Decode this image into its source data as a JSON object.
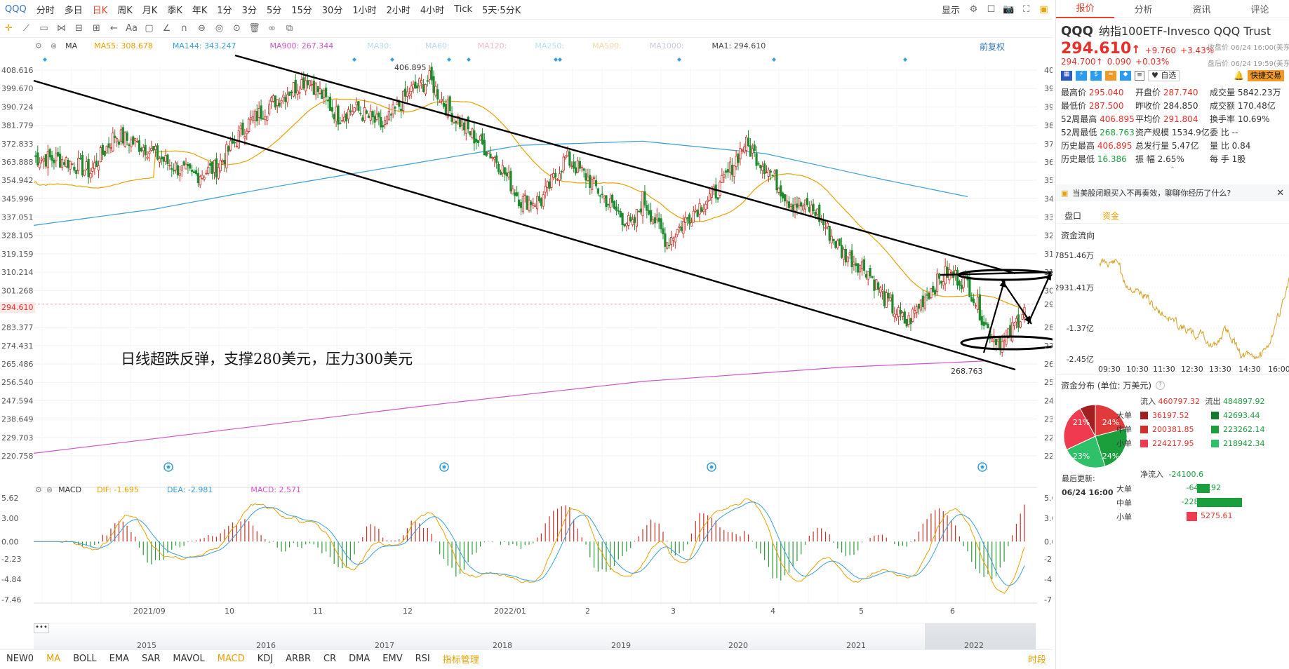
{
  "toolbar": {
    "periods": [
      "QQQ",
      "分时",
      "多日",
      "日K",
      "周K",
      "月K",
      "季K",
      "年K",
      "1分",
      "3分",
      "5分",
      "15分",
      "30分",
      "1小时",
      "2小时",
      "4小时",
      "Tick",
      "5天·5分K"
    ],
    "active_period": "日K",
    "display_label": "显示"
  },
  "ma_legend": {
    "ma_label": "MA",
    "ma55": "MA55: 308.678",
    "ma144": "MA144: 343.247",
    "ma900": "MA900: 267.344",
    "ma30": "MA30:",
    "ma60": "MA60:",
    "ma120": "MA120:",
    "ma250": "MA250:",
    "ma500": "MA500:",
    "ma1000": "MA1000:",
    "ma1": "MA1: 294.610",
    "fuquan": "前复权"
  },
  "price_axis": [
    "408.616",
    "399.670",
    "390.724",
    "381.779",
    "372.833",
    "363.888",
    "354.942",
    "345.996",
    "337.051",
    "328.105",
    "319.159",
    "310.214",
    "301.268",
    "294.610",
    "283.377",
    "274.431",
    "265.486",
    "256.540",
    "247.594",
    "238.649",
    "229.703",
    "220.758"
  ],
  "current_price_label": "294.610",
  "annotations": {
    "high_label": "406.895",
    "low_label": "268.763",
    "commentary": "日线超跌反弹，支撑280美元，压力300美元"
  },
  "macd_legend": {
    "name": "MACD",
    "dif": "DIF: -1.695",
    "dea": "DEA: -2.981",
    "macd": "MACD: 2.571"
  },
  "macd_axis": [
    "5.62",
    "3.00",
    "0.00",
    "-2.23",
    "-4.84",
    "-7.46"
  ],
  "time_axis": [
    "2021/09",
    "10",
    "11",
    "12",
    "2022/01",
    "2",
    "3",
    "4",
    "5",
    "6"
  ],
  "overview_years": [
    "2015",
    "2016",
    "2017",
    "2018",
    "2019",
    "2020",
    "2021",
    "2022"
  ],
  "indicators": [
    "NEW0",
    "MA",
    "BOLL",
    "EMA",
    "SAR",
    "MAVOL",
    "MACD",
    "KDJ",
    "ARBR",
    "CR",
    "DMA",
    "EMV",
    "RSI",
    "指标管理"
  ],
  "indicator_active": [
    "MA",
    "MACD"
  ],
  "right_bottom_label": "时段",
  "right_panel": {
    "tabs": [
      "报价",
      "分析",
      "资讯",
      "评论"
    ],
    "symbol": "QQQ",
    "name": "纳指100ETF-Invesco QQQ Trust",
    "price": "294.610",
    "change": "+9.760",
    "change_pct": "+3.43%",
    "close_time": "收盘价 06/24 16:00(美东)",
    "after_price": "294.700",
    "after_change": "0.090",
    "after_pct": "+0.03%",
    "after_time": "盘后价 06/24 19:59(美东)",
    "watch_label": "自选",
    "quick_trade": "快捷交易",
    "stats": [
      [
        {
          "k": "最高价",
          "v": "295.040",
          "c": "red"
        },
        {
          "k": "开盘价",
          "v": "287.740",
          "c": "red"
        },
        {
          "k": "成交量",
          "v": "5842.23万",
          "c": ""
        }
      ],
      [
        {
          "k": "最低价",
          "v": "287.500",
          "c": "red"
        },
        {
          "k": "昨收价",
          "v": "284.850",
          "c": ""
        },
        {
          "k": "成交额",
          "v": "170.48亿",
          "c": ""
        }
      ],
      [
        {
          "k": "52周最高",
          "v": "406.895",
          "c": "red"
        },
        {
          "k": "平均价",
          "v": "291.804",
          "c": "red"
        },
        {
          "k": "换手率",
          "v": "10.69%",
          "c": ""
        }
      ],
      [
        {
          "k": "52周最低",
          "v": "268.763",
          "c": "green"
        },
        {
          "k": "资产规模",
          "v": "1534.9亿",
          "c": ""
        },
        {
          "k": "委    比",
          "v": "--",
          "c": ""
        }
      ],
      [
        {
          "k": "历史最高",
          "v": "406.895",
          "c": "red"
        },
        {
          "k": "总发行量",
          "v": "5.47亿",
          "c": ""
        },
        {
          "k": "量    比",
          "v": "0.84",
          "c": ""
        }
      ],
      [
        {
          "k": "历史最低",
          "v": "16.386",
          "c": "green"
        },
        {
          "k": "振    幅",
          "v": "2.65%",
          "c": ""
        },
        {
          "k": "每    手",
          "v": "1股",
          "c": ""
        }
      ]
    ],
    "notice": "当美股闭眼买入不再奏效，聊聊你经历了什么?",
    "sub_tabs": [
      "盘口",
      "资金"
    ],
    "flow_title": "资金流向",
    "flow_axis": [
      "7851.46万",
      "-2931.41万",
      "-1.37亿",
      "-2.45亿"
    ],
    "flow_times": [
      "09:30",
      "10:30",
      "11:30",
      "12:30",
      "13:30",
      "14:30",
      "16:00"
    ],
    "dist_title": "资金分布 (单位: 万美元)",
    "pie_labels": [
      "21%",
      "24%",
      "24%",
      "23%"
    ],
    "inflow_label": "流入",
    "inflow_total": "460797.32",
    "outflow_label": "流出",
    "outflow_total": "484897.92",
    "rows": [
      {
        "k": "大单",
        "in": "36197.52",
        "out": "42693.44"
      },
      {
        "k": "中单",
        "in": "200381.85",
        "out": "223262.14"
      },
      {
        "k": "小单",
        "in": "224217.95",
        "out": "218942.34"
      }
    ],
    "last_update_label": "最后更新:",
    "last_update": "06/24 16:00",
    "net_label": "净流入",
    "net_total": "-24100.6",
    "net_rows": [
      {
        "k": "大单",
        "v": "-6495.92",
        "frac": 0.28
      },
      {
        "k": "中单",
        "v": "-22880.29",
        "frac": 1.0
      },
      {
        "k": "小单",
        "v": "5275.61",
        "frac": 0.23
      }
    ]
  }
}
